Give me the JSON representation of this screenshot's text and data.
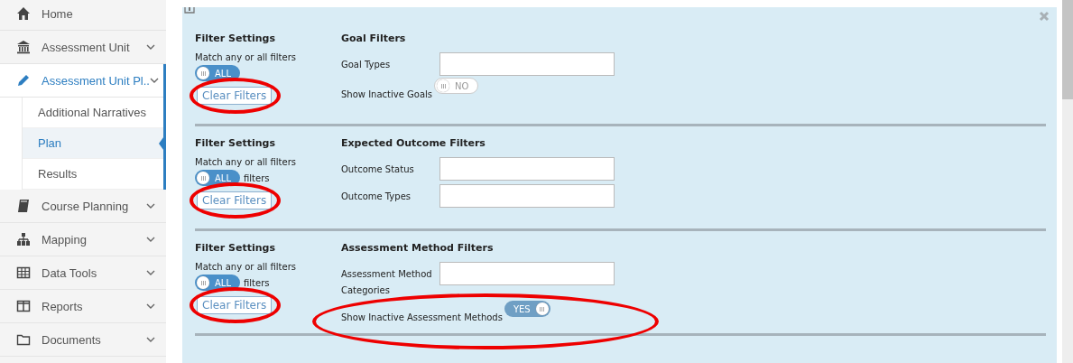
{
  "sidebar": {
    "items": [
      {
        "label": "Home",
        "expanded": false,
        "has_chevron": false
      },
      {
        "label": "Assessment Unit",
        "expanded": false,
        "has_chevron": true
      },
      {
        "label": "Assessment Unit Pl..",
        "expanded": true,
        "has_chevron": true,
        "children": [
          {
            "label": "Additional Narratives",
            "selected": false
          },
          {
            "label": "Plan",
            "selected": true
          },
          {
            "label": "Results",
            "selected": false
          }
        ]
      },
      {
        "label": "Course Planning",
        "expanded": false,
        "has_chevron": true
      },
      {
        "label": "Mapping",
        "expanded": false,
        "has_chevron": true
      },
      {
        "label": "Data Tools",
        "expanded": false,
        "has_chevron": true
      },
      {
        "label": "Reports",
        "expanded": false,
        "has_chevron": true
      },
      {
        "label": "Documents",
        "expanded": false,
        "has_chevron": true
      }
    ]
  },
  "sections": [
    {
      "settings": {
        "title": "Filter Settings",
        "match_label": "Match any or all filters",
        "toggle": {
          "label": "ALL",
          "on": false
        },
        "clear_button": {
          "label": "Clear Filters",
          "circled": true
        }
      },
      "filters": {
        "title": "Goal Filters",
        "rows": [
          {
            "kind": "field",
            "label": "Goal Types",
            "value": ""
          },
          {
            "kind": "toggle",
            "label": "Show Inactive Goals",
            "toggle": {
              "label": "NO",
              "on": false
            }
          }
        ]
      }
    },
    {
      "settings": {
        "title": "Filter Settings",
        "match_label": "Match any or all filters",
        "toggle": {
          "label": "ALL",
          "on": false
        },
        "toggle_note": "filters",
        "clear_button": {
          "label": "Clear Filters",
          "circled": true
        }
      },
      "filters": {
        "title": "Expected Outcome Filters",
        "rows": [
          {
            "kind": "field",
            "label": "Outcome Status",
            "value": ""
          },
          {
            "kind": "field",
            "label": "Outcome Types",
            "value": ""
          }
        ]
      }
    },
    {
      "settings": {
        "title": "Filter Settings",
        "match_label": "Match any or all filters",
        "toggle": {
          "label": "ALL",
          "on": false
        },
        "toggle_note": "filters",
        "clear_button": {
          "label": "Clear Filters",
          "circled": true
        }
      },
      "filters": {
        "title": "Assessment Method Filters",
        "rows": [
          {
            "kind": "field",
            "label": "Assessment Method Categories",
            "value": ""
          },
          {
            "kind": "toggle",
            "label": "Show Inactive Assessment Methods",
            "toggle": {
              "label": "YES",
              "on": true
            },
            "circled": true
          }
        ]
      }
    }
  ]
}
